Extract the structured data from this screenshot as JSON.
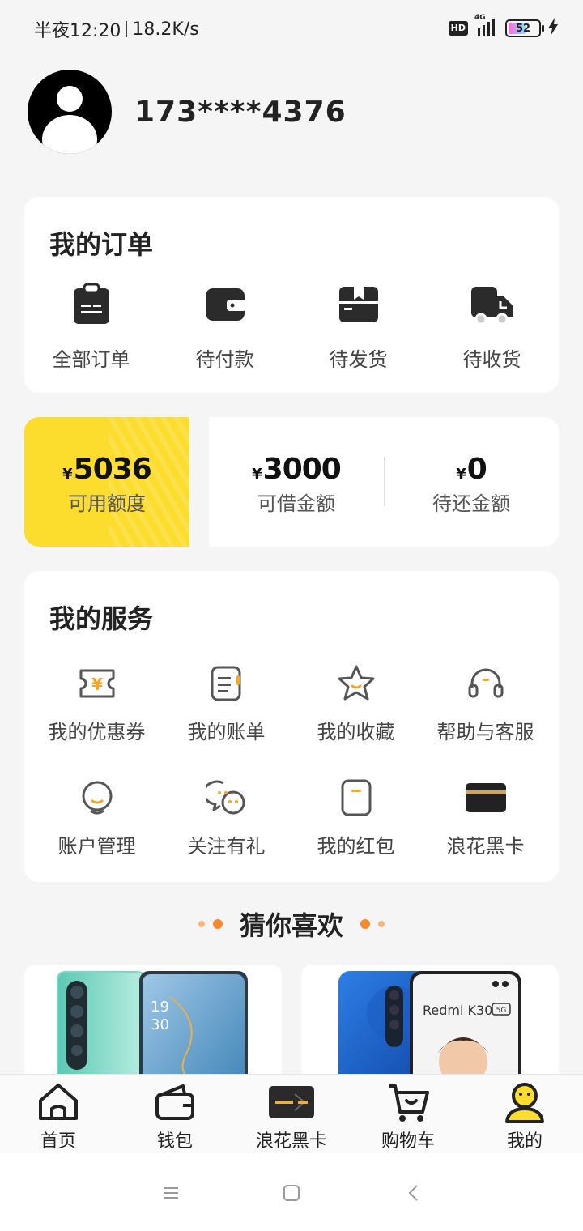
{
  "status": {
    "time": "半夜12:20",
    "speed": "18.2K/s",
    "hd": "HD",
    "network": "4G",
    "battery": "52"
  },
  "profile": {
    "phone": "173****4376"
  },
  "orders": {
    "title": "我的订单",
    "items": [
      {
        "label": "全部订单",
        "icon": "clipboard-icon"
      },
      {
        "label": "待付款",
        "icon": "wallet-icon"
      },
      {
        "label": "待发货",
        "icon": "box-icon"
      },
      {
        "label": "待收货",
        "icon": "truck-icon"
      }
    ]
  },
  "credit": {
    "available": {
      "currency": "¥",
      "amount": "5036",
      "label": "可用额度"
    },
    "borrowable": {
      "currency": "¥",
      "amount": "3000",
      "label": "可借金额"
    },
    "repay": {
      "currency": "¥",
      "amount": "0",
      "label": "待还金额"
    }
  },
  "services": {
    "title": "我的服务",
    "items": [
      {
        "label": "我的优惠券",
        "icon": "coupon-icon"
      },
      {
        "label": "我的账单",
        "icon": "bill-icon"
      },
      {
        "label": "我的收藏",
        "icon": "star-icon"
      },
      {
        "label": "帮助与客服",
        "icon": "headset-icon"
      },
      {
        "label": "账户管理",
        "icon": "account-icon"
      },
      {
        "label": "关注有礼",
        "icon": "chat-icon"
      },
      {
        "label": "我的红包",
        "icon": "red-packet-icon"
      },
      {
        "label": "浪花黑卡",
        "icon": "black-card-icon"
      }
    ]
  },
  "guess": {
    "title": "猜你喜欢"
  },
  "products": [
    {
      "screen_text": "19\n30"
    },
    {
      "brand": "Redmi K30",
      "badge": "5G"
    }
  ],
  "tabs": [
    {
      "label": "首页",
      "icon": "home-icon"
    },
    {
      "label": "钱包",
      "icon": "wallet-icon"
    },
    {
      "label": "浪花黑卡",
      "icon": "black-card-icon"
    },
    {
      "label": "购物车",
      "icon": "cart-icon"
    },
    {
      "label": "我的",
      "icon": "profile-icon"
    }
  ],
  "colors": {
    "accent": "#fcdc2c",
    "accent_orange": "#f5892f",
    "dark": "#222222"
  }
}
